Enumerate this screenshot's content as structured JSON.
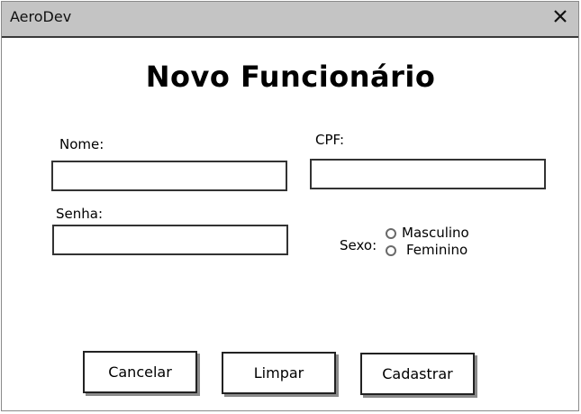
{
  "window": {
    "title": "AeroDev"
  },
  "form": {
    "heading": "Novo Funcionário",
    "nome": {
      "label": "Nome:",
      "value": "",
      "placeholder": ""
    },
    "cpf": {
      "label": "CPF:",
      "value": "",
      "placeholder": ""
    },
    "senha": {
      "label": "Senha:",
      "value": "",
      "placeholder": ""
    },
    "sexo": {
      "label": "Sexo:",
      "options": [
        "Masculino",
        "Feminino"
      ],
      "selected": null
    }
  },
  "buttons": {
    "cancel": "Cancelar",
    "clear": "Limpar",
    "submit": "Cadastrar"
  },
  "icons": {
    "close": "close-icon"
  },
  "colors": {
    "titlebar": "#c4c4c4",
    "border": "#333333",
    "shadow": "#8a8a8a"
  }
}
